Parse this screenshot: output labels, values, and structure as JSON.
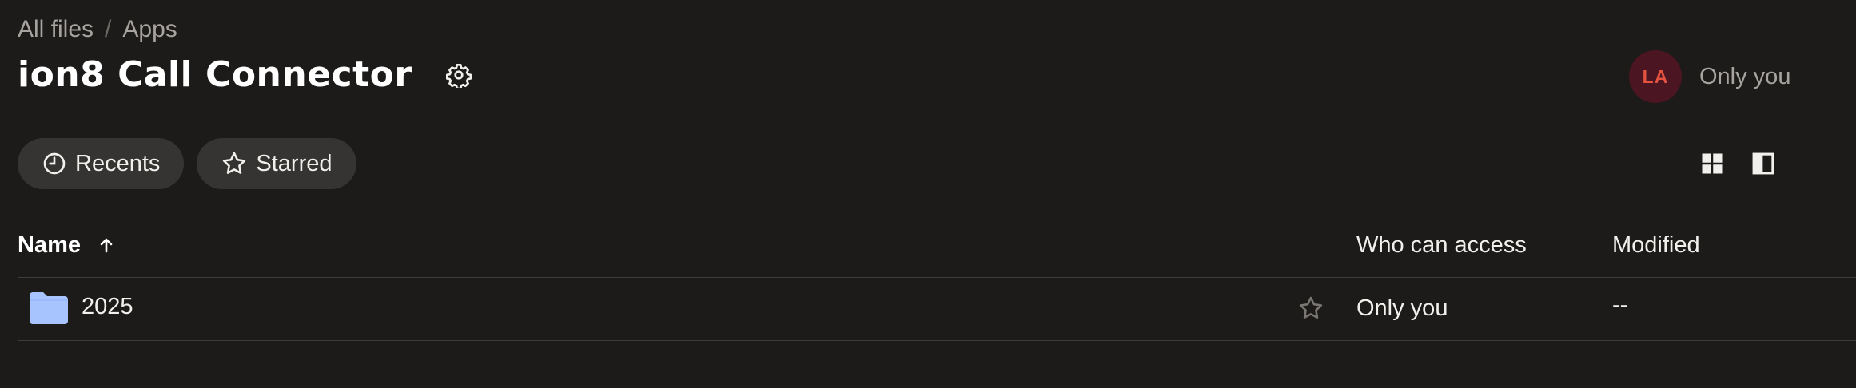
{
  "breadcrumb": {
    "items": [
      "All files",
      "Apps"
    ],
    "separator": "/"
  },
  "header": {
    "title": "ion8 Call Connector",
    "settings_icon": "gear-icon"
  },
  "access": {
    "avatar_initials": "LA",
    "label": "Only you",
    "avatar_bg": "#4b1521",
    "avatar_fg": "#e3533f"
  },
  "filters": [
    {
      "label": "Recents",
      "icon": "clock-icon"
    },
    {
      "label": "Starred",
      "icon": "star-icon"
    }
  ],
  "view_toggles": [
    {
      "icon": "grid-view-icon"
    },
    {
      "icon": "side-panel-icon"
    }
  ],
  "table": {
    "columns": {
      "name": "Name",
      "name_sort": "ascending",
      "access": "Who can access",
      "modified": "Modified"
    },
    "rows": [
      {
        "type": "folder",
        "name": "2025",
        "access": "Only you",
        "modified": "--",
        "starred": false
      }
    ]
  },
  "colors": {
    "background": "#1c1b1a",
    "chip_bg": "#353432",
    "folder": "#a7c4ff",
    "text_muted": "#a7a4a0"
  }
}
